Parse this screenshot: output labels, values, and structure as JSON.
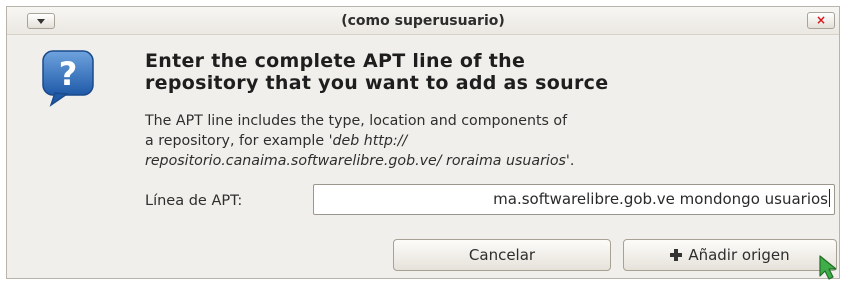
{
  "window": {
    "title": "(como superusuario)",
    "close_label": "×"
  },
  "dialog": {
    "icon": "question-icon",
    "heading_line1": "Enter the complete APT line of the",
    "heading_line2": "repository that you want to add as source",
    "desc_line1": "The APT line includes the type, location and components of",
    "desc_line2_prefix": "a repository, for example  ",
    "desc_line2_example": "'deb http://",
    "desc_line3_example": "repositorio.canaima.softwarelibre.gob.ve/ roraima usuarios",
    "desc_line3_suffix": "'.",
    "apt_label": "Línea de APT:",
    "apt_value": "ma.softwarelibre.gob.ve mondongo usuarios"
  },
  "buttons": {
    "cancel": "Cancelar",
    "add": "Añadir origen",
    "add_icon": "plus-icon"
  },
  "colors": {
    "dialog_bg": "#f1efeb",
    "icon_blue": "#2f6db5",
    "cursor_green": "#3fae49"
  }
}
